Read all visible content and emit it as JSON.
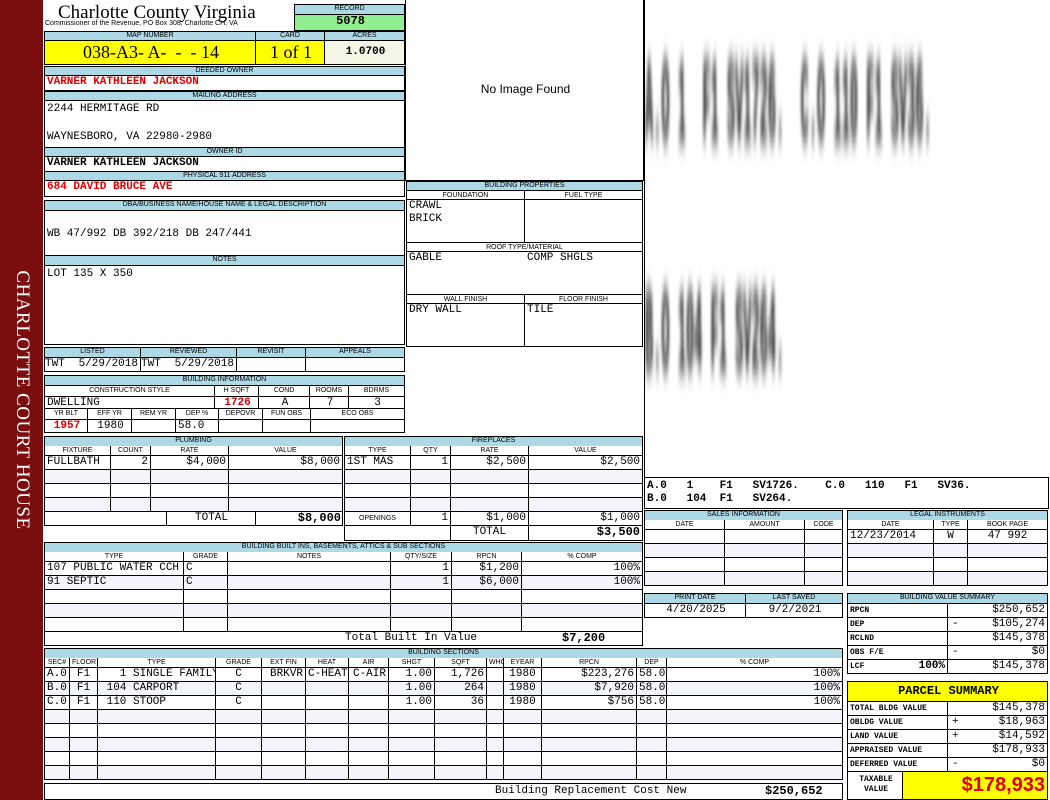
{
  "sidebar": {
    "text": "CHARLOTTE COURT HOUSE"
  },
  "header": {
    "title": "Charlotte County Virginia",
    "subtitle": "Commissioner of the Revenue, PO Box 308, Charlotte CH, VA",
    "record_label": "RECORD",
    "record": "5078"
  },
  "parcel": {
    "map_label": "MAP NUMBER",
    "map": "038-A3- A-  -  - 14",
    "card_label": "CARD",
    "card": "1 of 1",
    "acres_label": "ACRES",
    "acres": "1.0700"
  },
  "owner": {
    "deeded_label": "DEEDED OWNER",
    "deeded": "VARNER KATHLEEN JACKSON",
    "mailing_label": "MAILING ADDRESS",
    "mail1": "2244 HERMITAGE RD",
    "mail2": "WAYNESBORO, VA 22980-2980",
    "id_label": "OWNER ID",
    "id": "VARNER KATHLEEN JACKSON",
    "phys_label": "PHYSICAL 911 ADDRESS",
    "phys": "684 DAVID BRUCE AVE"
  },
  "dba": {
    "label": "DBA/BUSINESS NAME/HOUSE NAME & LEGAL DESCRIPTION",
    "text": "WB 47/992 DB 392/218 DB 247/441"
  },
  "notes": {
    "label": "NOTES",
    "text": "LOT 135 X 350"
  },
  "image": {
    "text": "No Image Found"
  },
  "props": {
    "label": "BUILDING PROPERTIES",
    "foundation_label": "FOUNDATION",
    "foundation1": "CRAWL",
    "foundation2": "BRICK",
    "fuel_label": "FUEL TYPE",
    "roof_label": "ROOF TYPE/MATERIAL",
    "roof_type": "GABLE",
    "roof_mat": "COMP SHGLS",
    "wall_label": "WALL FINISH",
    "wall": "DRY WALL",
    "floor_label": "FLOOR FINISH",
    "floor": "TILE"
  },
  "review": {
    "listed_label": "LISTED",
    "listed_by": "TWT",
    "listed": "5/29/2018",
    "reviewed_label": "REVIEWED",
    "reviewed_by": "TWT",
    "reviewed": "5/29/2018",
    "revisit_label": "REVISIT",
    "appeals_label": "APPEALS"
  },
  "bldg": {
    "label": "BUILDING INFORMATION",
    "style_label": "CONSTRUCTION STYLE",
    "style": "DWELLING",
    "hsqft_label": "H SQFT",
    "hsqft": "1726",
    "cond_label": "COND",
    "cond": "A",
    "rooms_label": "ROOMS",
    "rooms": "7",
    "bdrms_label": "BDRMS",
    "bdrms": "3",
    "yrblt_label": "YR BLT",
    "yrblt": "1957",
    "effyr_label": "EFF YR",
    "effyr": "1980",
    "remyr_label": "REM YR",
    "dep_label": "DEP %",
    "dep": "58.0",
    "depovr_label": "DEPOVR",
    "funobs_label": "FUN OBS",
    "ecoobs_label": "ECO OBS"
  },
  "plumbing": {
    "label": "PLUMBING",
    "cols": [
      "FIXTURE",
      "COUNT",
      "RATE",
      "VALUE"
    ],
    "rows": [
      [
        "FULLBATH",
        "2",
        "$4,000",
        "$8,000"
      ],
      [
        "",
        "",
        "",
        ""
      ],
      [
        "",
        "",
        "",
        ""
      ],
      [
        "",
        "",
        "",
        ""
      ]
    ],
    "total_label": "TOTAL",
    "total": "$8,000"
  },
  "fireplaces": {
    "label": "FIREPLACES",
    "cols": [
      "TYPE",
      "QTY",
      "RATE",
      "VALUE"
    ],
    "rows": [
      [
        "1ST MAS",
        "1",
        "$2,500",
        "$2,500"
      ],
      [
        "",
        "",
        "",
        ""
      ],
      [
        "",
        "",
        "",
        ""
      ],
      [
        "",
        "",
        "",
        ""
      ]
    ],
    "openings_label": "OPENINGS",
    "openings_qty": "1",
    "openings_rate": "$1,000",
    "openings_value": "$1,000",
    "total_label": "TOTAL",
    "total": "$3,500"
  },
  "builtins": {
    "label": "BUILDING BUILT INS, BASEMENTS, ATTICS & SUB SECTIONS",
    "cols": [
      "TYPE",
      "GRADE",
      "NOTES",
      "QTY/SIZE",
      "RPCN",
      "% COMP"
    ],
    "rows": [
      [
        "107 PUBLIC WATER CCH",
        "C",
        "",
        "1",
        "$1,200",
        "100%"
      ],
      [
        "91 SEPTIC",
        "C",
        "",
        "1",
        "$6,000",
        "100%"
      ],
      [
        "",
        "",
        "",
        "",
        "",
        ""
      ],
      [
        "",
        "",
        "",
        "",
        "",
        ""
      ],
      [
        "",
        "",
        "",
        "",
        "",
        ""
      ]
    ],
    "total_label": "Total Built In Value",
    "total": "$7,200"
  },
  "sections": {
    "label": "BUILDING SECTIONS",
    "cols": [
      "SEC#",
      "FLOOR",
      "TYPE",
      "GRADE",
      "EXT FIN",
      "HEAT",
      "AIR",
      "SHGT",
      "SQFT",
      "WHGT",
      "EYEAR",
      "RPCN",
      "DEP",
      "% COMP"
    ],
    "rows": [
      [
        "A.0",
        "F1",
        "   1 SINGLE FAMILY",
        "C",
        "BRKVR",
        "C-HEAT",
        "C-AIR",
        "1.00",
        "1,726",
        "",
        "1980",
        "$223,276",
        "58.0",
        "100%"
      ],
      [
        "B.0",
        "F1",
        " 104 CARPORT",
        "C",
        "",
        "",
        "",
        "1.00",
        "264",
        "",
        "1980",
        "$7,920",
        "58.0",
        "100%"
      ],
      [
        "C.0",
        "F1",
        " 110 STOOP",
        "C",
        "",
        "",
        "",
        "1.00",
        "36",
        "",
        "1980",
        "$756",
        "58.0",
        "100%"
      ],
      [
        "",
        "",
        "",
        "",
        "",
        "",
        "",
        "",
        "",
        "",
        "",
        "",
        "",
        ""
      ],
      [
        "",
        "",
        "",
        "",
        "",
        "",
        "",
        "",
        "",
        "",
        "",
        "",
        "",
        ""
      ],
      [
        "",
        "",
        "",
        "",
        "",
        "",
        "",
        "",
        "",
        "",
        "",
        "",
        "",
        ""
      ],
      [
        "",
        "",
        "",
        "",
        "",
        "",
        "",
        "",
        "",
        "",
        "",
        "",
        "",
        ""
      ],
      [
        "",
        "",
        "",
        "",
        "",
        "",
        "",
        "",
        "",
        "",
        "",
        "",
        "",
        ""
      ]
    ],
    "total_label": "Building Replacement Cost New",
    "total": "$250,652"
  },
  "sketch": {
    "line1": "A.O 1  F1 SV1726.  C.O 110 F1 SV36.",
    "line2": "B.O 104 F1 SV264.",
    "legend1": "A.0   1    F1   SV1726.    C.0   110   F1   SV36.",
    "legend2": "B.0   104  F1   SV264."
  },
  "sales": {
    "label": "SALES INFORMATION",
    "cols": [
      "DATE",
      "AMOUNT",
      "CODE"
    ],
    "rows": [
      [
        "",
        "",
        ""
      ],
      [
        "",
        "",
        ""
      ],
      [
        "",
        "",
        ""
      ],
      [
        "",
        "",
        ""
      ]
    ]
  },
  "legal": {
    "label": "LEGAL INSTRUMENTS",
    "cols": [
      "DATE",
      "TYPE",
      "BOOK PAGE"
    ],
    "rows": [
      [
        "12/23/2014",
        "W",
        "47 992"
      ],
      [
        "",
        "",
        ""
      ],
      [
        "",
        "",
        ""
      ],
      [
        "",
        "",
        ""
      ]
    ]
  },
  "dates": {
    "print_label": "PRINT DATE",
    "print": "4/20/2025",
    "saved_label": "LAST SAVED",
    "saved": "9/2/2021"
  },
  "bvs": {
    "label": "BUILDING VALUE SUMMARY",
    "rows": [
      {
        "k": "RPCN",
        "p": "",
        "s": "",
        "v": "$250,652"
      },
      {
        "k": "DEP",
        "p": "",
        "s": "-",
        "v": "$105,274"
      },
      {
        "k": "RCLND",
        "p": "",
        "s": "",
        "v": "$145,378"
      },
      {
        "k": "OBS F/E",
        "p": "",
        "s": "-",
        "v": "$0"
      },
      {
        "k": "LCF",
        "p": "100%",
        "s": "",
        "v": "$145,378"
      }
    ]
  },
  "summary": {
    "label": "PARCEL SUMMARY",
    "rows": [
      {
        "k": "TOTAL BLDG VALUE",
        "s": "",
        "v": "$145,378"
      },
      {
        "k": "OBLDG VALUE",
        "s": "+",
        "v": "$18,963"
      },
      {
        "k": "LAND VALUE",
        "s": "+",
        "v": "$14,592"
      },
      {
        "k": "APPRAISED VALUE",
        "s": "",
        "v": "$178,933"
      },
      {
        "k": "DEFERRED VALUE",
        "s": "-",
        "v": "$0"
      }
    ],
    "taxable_label": "TAXABLE VALUE",
    "taxable": "$178,933"
  },
  "colors": {
    "sidebar": "#7a0d0d",
    "header": "#add8e6",
    "highlight": "#ffff00",
    "record": "#90ee90",
    "value_red": "#e00000"
  }
}
